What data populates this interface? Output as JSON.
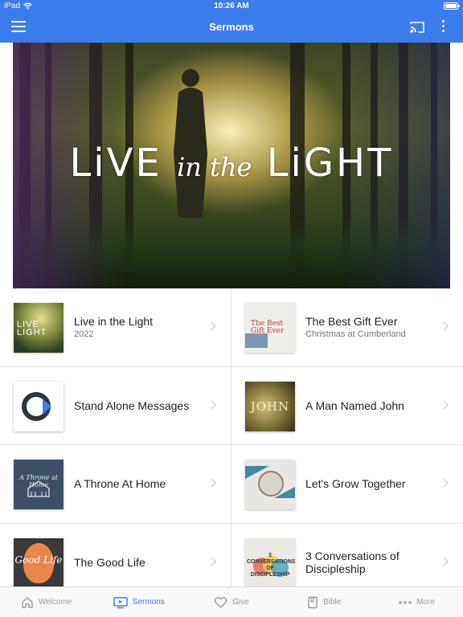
{
  "status_bar": {
    "device": "iPad",
    "time": "10:26 AM"
  },
  "nav": {
    "title": "Sermons"
  },
  "hero": {
    "title_a": "LiVE",
    "title_script": "in the",
    "title_b": "LiGHT"
  },
  "series": [
    {
      "title": "Live in the Light",
      "subtitle": "2022",
      "thumb_text": "LIVE LIGHT"
    },
    {
      "title": "The Best Gift Ever",
      "subtitle": "Christmas at Cumberland",
      "thumb_text": "The Best Gift Ever"
    },
    {
      "title": "Stand Alone Messages",
      "subtitle": ""
    },
    {
      "title": "A Man Named John",
      "subtitle": "",
      "thumb_text": "JOHN"
    },
    {
      "title": "A Throne At Home",
      "subtitle": "",
      "thumb_text": "A Throne at Home"
    },
    {
      "title": "Let's Grow Together",
      "subtitle": ""
    },
    {
      "title": "The Good Life",
      "subtitle": "",
      "thumb_text": "Good Life"
    },
    {
      "title": "3 Conversations of Discipleship",
      "subtitle": "",
      "thumb_text": "3 CONVERSATIONS OF DISCIPLESHIP"
    }
  ],
  "tabs": [
    {
      "label": "Welcome",
      "icon": "home-icon"
    },
    {
      "label": "Sermons",
      "icon": "tv-icon",
      "active": true
    },
    {
      "label": "Give",
      "icon": "heart-icon"
    },
    {
      "label": "Bible",
      "icon": "book-icon"
    },
    {
      "label": "More",
      "icon": "ellipsis-icon"
    }
  ],
  "colors": {
    "accent": "#3b7ded",
    "inactive": "#9a9a9a"
  }
}
